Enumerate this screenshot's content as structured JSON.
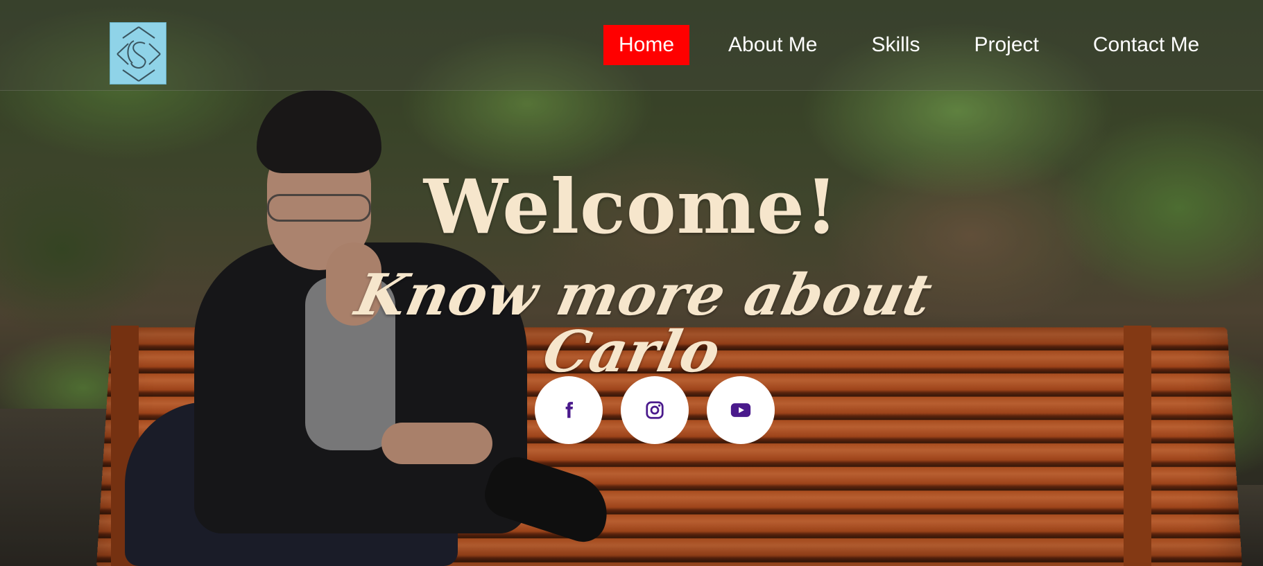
{
  "logo": {
    "icon": "cs-monogram-logo",
    "bg_color": "#8fd3e8"
  },
  "nav": {
    "items": [
      {
        "label": "Home",
        "active": true
      },
      {
        "label": "About Me",
        "active": false
      },
      {
        "label": "Skills",
        "active": false
      },
      {
        "label": "Project",
        "active": false
      },
      {
        "label": "Contact Me",
        "active": false
      }
    ],
    "active_color": "#ff0000",
    "text_color": "#ffffff"
  },
  "hero": {
    "title": "Welcome!",
    "subtitle": "Know more about Carlo",
    "text_color": "#f6e6cc"
  },
  "social": {
    "icons": [
      "facebook-icon",
      "instagram-icon",
      "youtube-icon"
    ],
    "icon_color": "#4a1a8c",
    "button_color": "#ffffff"
  }
}
